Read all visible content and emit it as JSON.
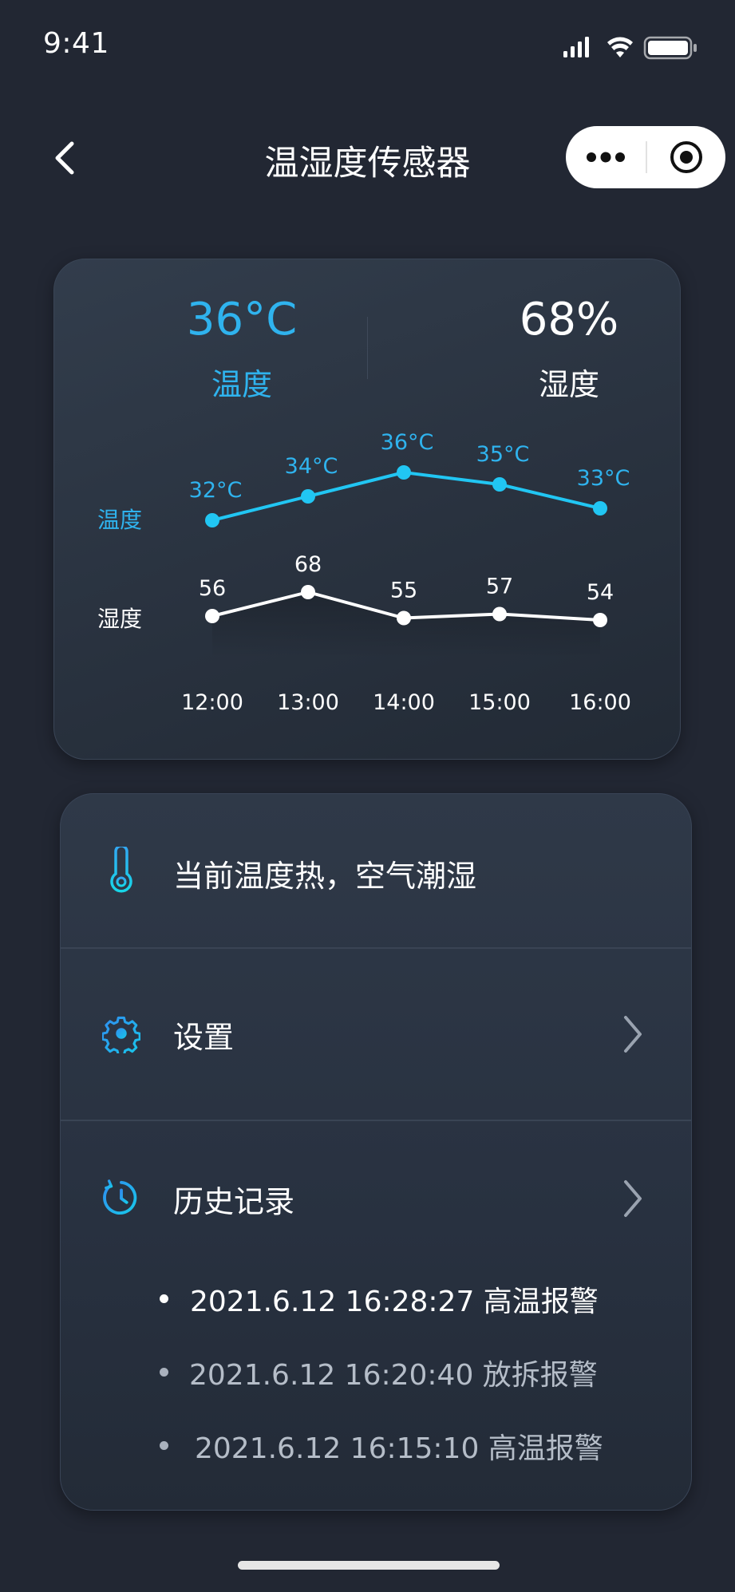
{
  "status_bar": {
    "time": "9:41"
  },
  "nav": {
    "title": "温湿度传感器"
  },
  "summary": {
    "temperature_value": "36°C",
    "temperature_label": "温度",
    "humidity_value": "68%",
    "humidity_label": "湿度"
  },
  "chart_data": {
    "type": "line",
    "categories": [
      "12:00",
      "13:00",
      "14:00",
      "15:00",
      "16:00"
    ],
    "series": [
      {
        "name": "温度",
        "values": [
          32,
          34,
          36,
          35,
          33
        ],
        "labels": [
          "32°C",
          "34°C",
          "36°C",
          "35°C",
          "33°C"
        ],
        "color": "#21c6f3"
      },
      {
        "name": "湿度",
        "values": [
          56,
          68,
          55,
          57,
          54
        ],
        "labels": [
          "56",
          "68",
          "55",
          "57",
          "54"
        ],
        "color": "#ffffff"
      }
    ],
    "legend": "left",
    "grid": false
  },
  "status_message": "当前温度热，空气潮湿",
  "menu": {
    "settings_label": "设置",
    "history_label": "历史记录"
  },
  "history": [
    {
      "text": "2021.6.12 16:28:27 高温报警"
    },
    {
      "text": "2021.6.12 16:20:40 放拆报警"
    },
    {
      "text": "2021.6.12 16:15:10 高温报警"
    }
  ],
  "colors": {
    "background": "#222733",
    "accent": "#2fb3ee",
    "temp_line": "#21c6f3",
    "humidity_line": "#ffffff"
  },
  "icons": {
    "back": "chevron-left-icon",
    "more": "more-dots-icon",
    "close": "target-icon",
    "thermometer": "thermometer-icon",
    "settings": "gear-icon",
    "history": "history-clock-icon",
    "chevron": "chevron-right-icon"
  }
}
